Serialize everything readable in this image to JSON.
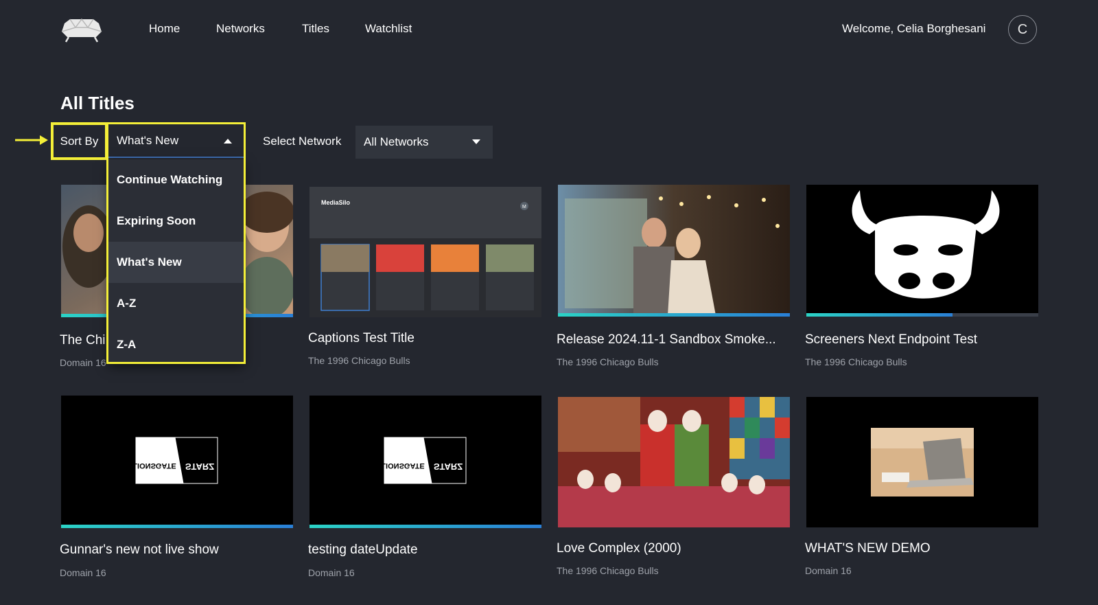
{
  "header": {
    "nav": [
      {
        "label": "Home"
      },
      {
        "label": "Networks"
      },
      {
        "label": "Titles"
      },
      {
        "label": "Watchlist"
      }
    ],
    "welcome": "Welcome, Celia Borghesani",
    "avatar_initial": "C"
  },
  "page_title": "All Titles",
  "sort": {
    "label": "Sort By",
    "selected": "What's New",
    "options": [
      {
        "label": "Continue Watching"
      },
      {
        "label": "Expiring Soon"
      },
      {
        "label": "What's New"
      },
      {
        "label": "A-Z"
      },
      {
        "label": "Z-A"
      }
    ]
  },
  "network": {
    "label": "Select Network",
    "selected": "All Networks"
  },
  "thumb_texts": {
    "mediasilo_brand": "MediaSilo",
    "mediasilo_avatar": "M",
    "logo_left": "LIONSGATE",
    "logo_right": "STARZ"
  },
  "titles": [
    {
      "title": "The Chi",
      "subtitle": "Domain 16",
      "progress": 1.0
    },
    {
      "title": "Captions Test Title",
      "subtitle": "The 1996 Chicago Bulls",
      "progress": 0
    },
    {
      "title": "Release 2024.11-1 Sandbox Smoke...",
      "subtitle": "The 1996 Chicago Bulls",
      "progress": 1.0
    },
    {
      "title": "Screeners Next Endpoint Test",
      "subtitle": "The 1996 Chicago Bulls",
      "progress": 0.63
    },
    {
      "title": "Gunnar's new not live show",
      "subtitle": "Domain 16",
      "progress": 1.0
    },
    {
      "title": "testing dateUpdate",
      "subtitle": "Domain 16",
      "progress": 1.0
    },
    {
      "title": "Love Complex (2000)",
      "subtitle": "The 1996 Chicago Bulls",
      "progress": 0
    },
    {
      "title": "WHAT'S NEW DEMO",
      "subtitle": "Domain 16",
      "progress": 0
    }
  ],
  "colors": {
    "background": "#24272f",
    "highlight": "#f4ef38",
    "progress_start": "#2bd3c6",
    "progress_end": "#2a7fd6"
  },
  "icons": {
    "logo": "sofa-logo-icon",
    "sort_caret": "caret-up-icon",
    "network_caret": "caret-down-icon",
    "annotation": "arrow-right-icon"
  }
}
